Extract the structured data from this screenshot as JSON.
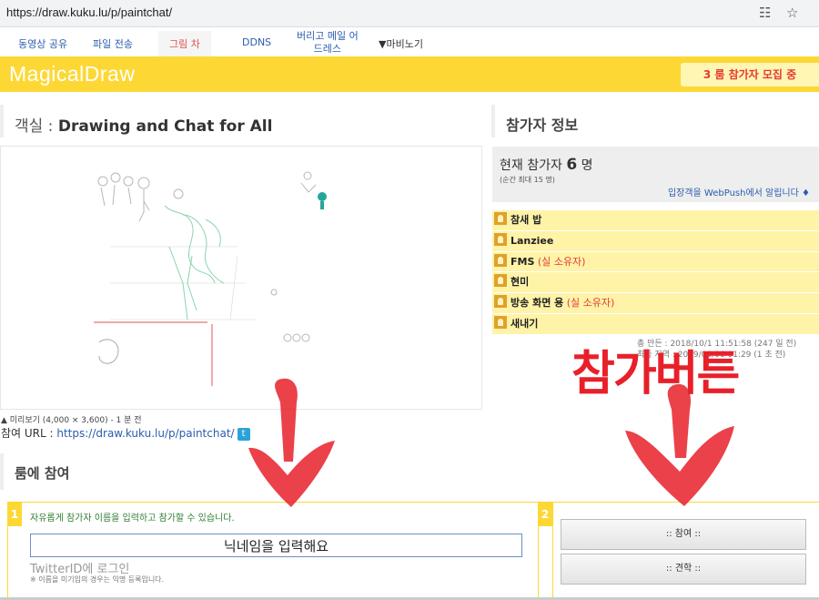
{
  "browser": {
    "url": "https://draw.kuku.lu/p/paintchat/",
    "translate_icon": "translate-icon",
    "bookmark_icon": "star-icon"
  },
  "nav": {
    "items": [
      {
        "label": "동영상 공유"
      },
      {
        "label": "파일 전송"
      },
      {
        "label": "그림 차"
      },
      {
        "label": "DDNS"
      },
      {
        "label_line1": "버리고 메일 어",
        "label_line2": "드레스"
      },
      {
        "label": "▼마비노기"
      }
    ]
  },
  "header": {
    "logo": "MagicalDraw",
    "recruit": "3 룸 참가자 모집 중",
    "bg_color": "#fdd835"
  },
  "room": {
    "title_prefix": "객실 : ",
    "title_name": "Drawing and Chat for All",
    "preview_caption": "▲ 미리보기 (4,000 × 3,600) - 1 분 전",
    "join_url_label": "참여 URL : ",
    "join_url": "https://draw.kuku.lu/p/paintchat/"
  },
  "join": {
    "heading": "룸에 참여",
    "step1_num": "1",
    "step2_num": "2",
    "hint": "자유롭게 참가자 이름을 입력하고 참가할 수 있습니다.",
    "nickname_value": "닉네임을 입력해요",
    "twitter_login": "TwitterID에 로그인",
    "note": "※ 이름을 미기입의 경우는 익명 등록입니다.",
    "join_button": ":: 참여 ::",
    "watch_button": ":: 견학 ::"
  },
  "participants": {
    "heading": "참가자 정보",
    "current_label": "현재 참가자",
    "current_count": "6",
    "unit": "명",
    "peak": "(순간 최대 15 명)",
    "webpush": "입장객을 WebPush에서 알립니다",
    "webpush_icon": "bell-icon",
    "list": [
      {
        "name": "참새 밥",
        "owner": ""
      },
      {
        "name": "Lanziee",
        "owner": ""
      },
      {
        "name": "FMS",
        "owner": " (실 소유자)"
      },
      {
        "name": "현미",
        "owner": ""
      },
      {
        "name": "방송 화면 용",
        "owner": " (실 소유자)"
      },
      {
        "name": "새내기",
        "owner": ""
      }
    ],
    "time_line1": "총 만든 : 2018/10/1 11:51:58 (247 일 전)",
    "time_line2": "최종 지역 : 2019/06/06 01:29 (1 초 전)"
  },
  "annotation": {
    "text": "참가버튼",
    "color": "#e8202a"
  }
}
